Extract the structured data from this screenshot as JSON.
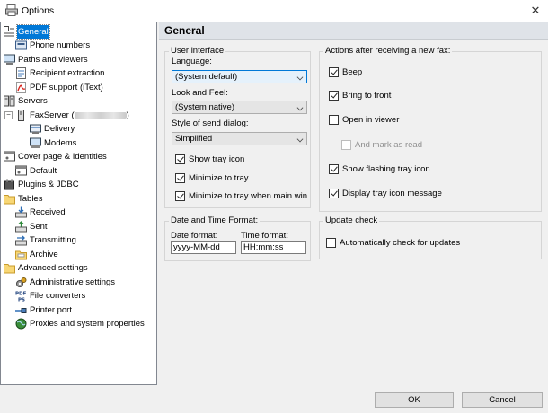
{
  "window": {
    "title": "Options",
    "close_glyph": "✕"
  },
  "tree": {
    "items": [
      {
        "label": "General",
        "icon": "general-icon",
        "selected": true
      },
      {
        "label": "Phone numbers",
        "icon": "phone-numbers-icon"
      },
      {
        "label": "Paths and viewers",
        "icon": "paths-viewers-icon"
      },
      {
        "label": "Recipient extraction",
        "icon": "recipient-extraction-icon"
      },
      {
        "label": "PDF support (iText)",
        "icon": "pdf-icon"
      },
      {
        "label": "Servers",
        "icon": "servers-icon"
      },
      {
        "label_prefix": "FaxServer (",
        "label_suffix": ")",
        "icon": "server-icon",
        "expanded": true
      },
      {
        "label": "Delivery",
        "icon": "delivery-icon"
      },
      {
        "label": "Modems",
        "icon": "modems-icon"
      },
      {
        "label": "Cover page & Identities",
        "icon": "cover-page-icon"
      },
      {
        "label": "Default",
        "icon": "default-identity-icon"
      },
      {
        "label": "Plugins & JDBC",
        "icon": "plugins-icon"
      },
      {
        "label": "Tables",
        "icon": "folder-icon"
      },
      {
        "label": "Received",
        "icon": "received-icon"
      },
      {
        "label": "Sent",
        "icon": "sent-icon"
      },
      {
        "label": "Transmitting",
        "icon": "transmitting-icon"
      },
      {
        "label": "Archive",
        "icon": "archive-icon"
      },
      {
        "label": "Advanced settings",
        "icon": "folder-icon"
      },
      {
        "label": "Administrative settings",
        "icon": "admin-settings-icon"
      },
      {
        "label": "File converters",
        "icon": "file-converters-icon"
      },
      {
        "label": "Printer port",
        "icon": "printer-port-icon"
      },
      {
        "label": "Proxies and system properties",
        "icon": "globe-icon"
      }
    ],
    "expander_glyph": "−"
  },
  "panel": {
    "title": "General",
    "ui_group": {
      "title": "User interface",
      "language_label": "Language:",
      "language_value": "(System default)",
      "lookfeel_label": "Look and Feel:",
      "lookfeel_value": "(System native)",
      "senddialog_label": "Style of send dialog:",
      "senddialog_value": "Simplified",
      "show_tray": {
        "label": "Show tray icon",
        "checked": true
      },
      "min_tray": {
        "label": "Minimize to tray",
        "checked": true
      },
      "min_tray_main": {
        "label": "Minimize to tray when main win...",
        "checked": true
      }
    },
    "actions_group": {
      "title": "Actions after receiving a new fax:",
      "beep": {
        "label": "Beep",
        "checked": true
      },
      "bring_front": {
        "label": "Bring to front",
        "checked": true
      },
      "open_viewer": {
        "label": "Open in viewer",
        "checked": false
      },
      "mark_read": {
        "label": "And mark as read",
        "checked": false,
        "disabled": true
      },
      "flash_tray": {
        "label": "Show flashing tray icon",
        "checked": true
      },
      "tray_msg": {
        "label": "Display tray icon message",
        "checked": true
      }
    },
    "datetime_group": {
      "title": "Date and Time Format:",
      "date_label": "Date format:",
      "date_value": "yyyy-MM-dd",
      "time_label": "Time format:",
      "time_value": "HH:mm:ss"
    },
    "update_group": {
      "title": "Update check",
      "auto_check": {
        "label": "Automatically check for updates",
        "checked": false
      }
    }
  },
  "footer": {
    "ok_label": "OK",
    "cancel_label": "Cancel"
  },
  "colors": {
    "selection": "#0078d7",
    "header_bg": "#dfe3e8",
    "window_bg": "#f0f0f0"
  }
}
